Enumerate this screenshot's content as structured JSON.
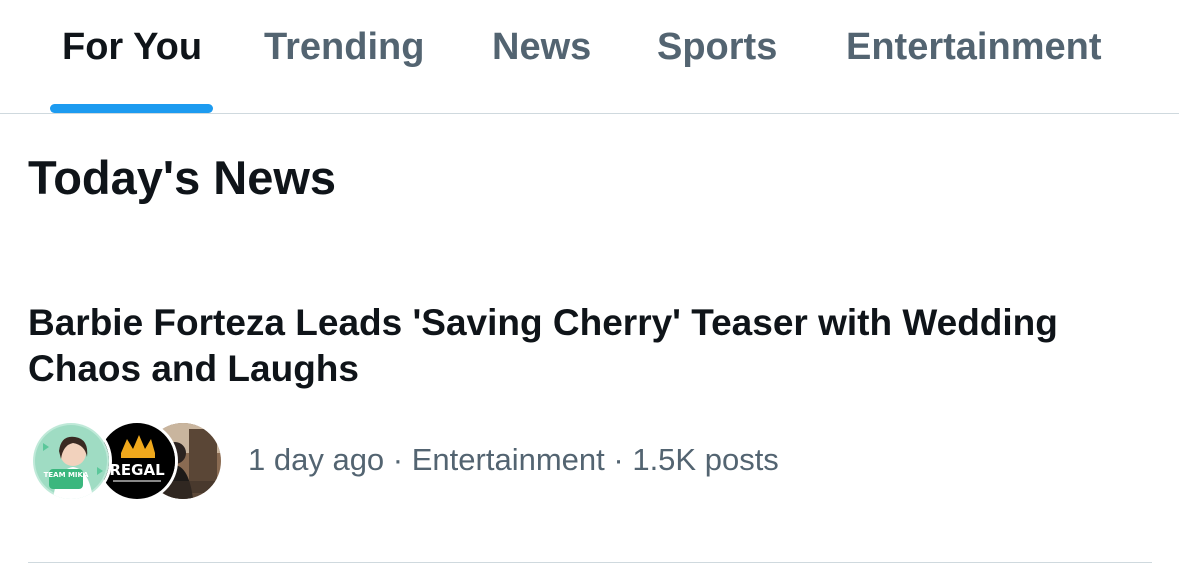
{
  "tabs": [
    {
      "label": "For You",
      "active": true
    },
    {
      "label": "Trending",
      "active": false
    },
    {
      "label": "News",
      "active": false
    },
    {
      "label": "Sports",
      "active": false
    },
    {
      "label": "Entertainment",
      "active": false
    }
  ],
  "colors": {
    "accent": "#1d9bf0",
    "text_primary": "#0f1419",
    "text_secondary": "#536471",
    "divider": "#cfd9de"
  },
  "section": {
    "title": "Today's News"
  },
  "news_item": {
    "headline": "Barbie Forteza Leads 'Saving Cherry' Teaser with Wedding Chaos and Laughs",
    "avatars": [
      {
        "name": "team-mika-avatar",
        "badge": "TEAM MIKA"
      },
      {
        "name": "regal-entertainment-avatar",
        "badge": "REGAL"
      },
      {
        "name": "person-avatar"
      }
    ],
    "time": "1 day ago",
    "separator": "·",
    "category": "Entertainment",
    "posts": "1.5K posts"
  }
}
